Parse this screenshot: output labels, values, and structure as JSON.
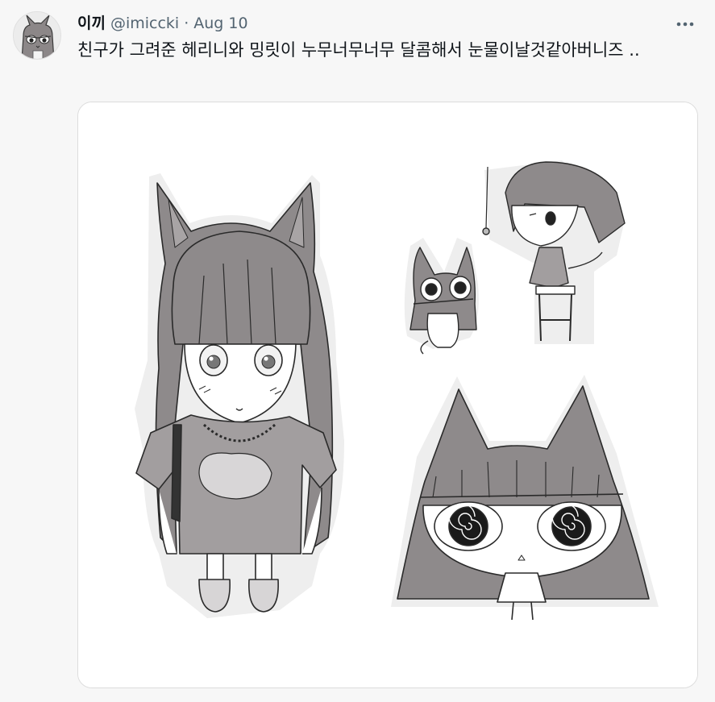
{
  "tweet": {
    "author": {
      "display_name": "이끼",
      "handle": "@imiccki"
    },
    "separator": "·",
    "date": "Aug 10",
    "text": "친구가 그려준 헤리니와 밍릿이 누무너무너무 달콤해서 눈물이날것같아버니즈 ..",
    "more_icon": "more-horizontal-icon",
    "media": {
      "alt": "illustration"
    }
  }
}
